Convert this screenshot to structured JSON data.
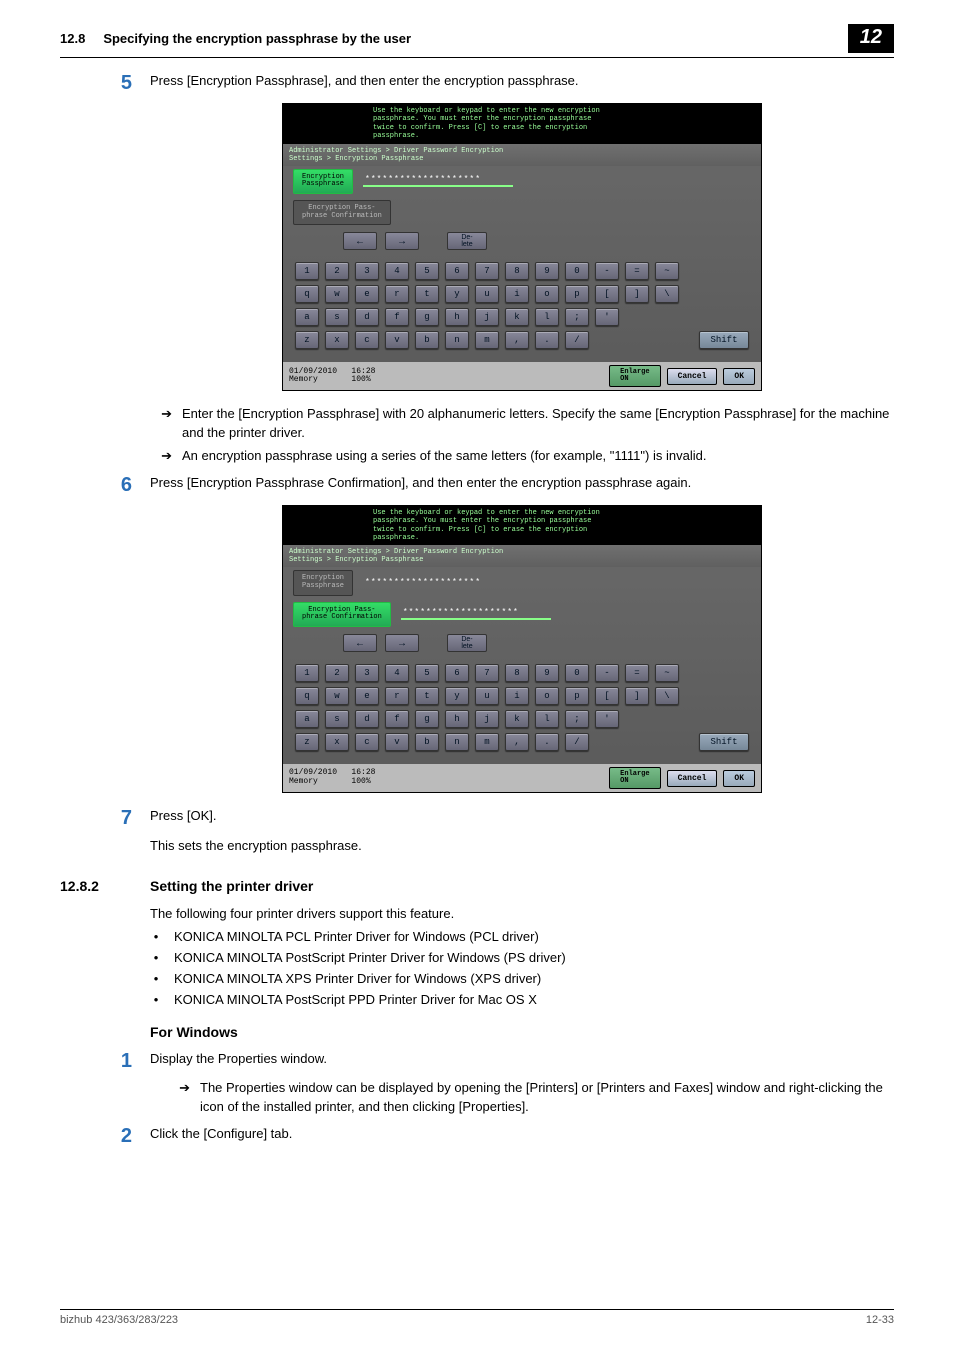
{
  "header": {
    "section_number": "12.8",
    "section_title": "Specifying the encryption passphrase by the user",
    "chapter_number": "12"
  },
  "footer": {
    "model": "bizhub 423/363/283/223",
    "page": "12-33"
  },
  "step5": {
    "num": "5",
    "text": "Press [Encryption Passphrase], and then enter the encryption passphrase.",
    "arrow1": "Enter the [Encryption Passphrase] with 20 alphanumeric letters. Specify the same [Encryption Passphrase] for the machine and the printer driver.",
    "arrow2": "An encryption passphrase using a series of the same letters (for example, \"1111\") is invalid."
  },
  "step6": {
    "num": "6",
    "text": "Press [Encryption Passphrase Confirmation], and then enter the encryption passphrase again."
  },
  "step7": {
    "num": "7",
    "text": "Press [OK].",
    "sub": "This sets the encryption passphrase."
  },
  "sec_1282": {
    "num": "12.8.2",
    "title": "Setting the printer driver",
    "intro": "The following four printer drivers support this feature.",
    "bullets": [
      "KONICA MINOLTA PCL Printer Driver for Windows (PCL driver)",
      "KONICA MINOLTA PostScript Printer Driver for Windows (PS driver)",
      "KONICA MINOLTA XPS Printer Driver for Windows (XPS driver)",
      "KONICA MINOLTA PostScript PPD Printer Driver for Mac OS X"
    ]
  },
  "for_windows": {
    "title": "For Windows",
    "step1_num": "1",
    "step1": "Display the Properties window.",
    "step1_arrow": "The Properties window can be displayed by opening the [Printers] or [Printers and Faxes] window and right-clicking the icon of the installed printer, and then clicking [Properties].",
    "step2_num": "2",
    "step2": "Click the [Configure] tab."
  },
  "screenshot": {
    "topmsg": "Use the keyboard or keypad to enter the new encryption\npassphrase. You must enter the encryption passphrase\ntwice to confirm. Press [C] to erase the encryption\npassphrase.",
    "breadcrumb": "Administrator Settings > Driver Password Encryption\nSettings > Encryption Passphrase",
    "field_encrypt_label": "Encryption\nPassphrase",
    "field_confirm_label": "Encryption Pass-\nphrase Confirmation",
    "value_masked": "********************",
    "delete_label": "De-\nlete",
    "shift_label": "Shift",
    "row_num": [
      "1",
      "2",
      "3",
      "4",
      "5",
      "6",
      "7",
      "8",
      "9",
      "0",
      "-",
      "=",
      "~"
    ],
    "row_q": [
      "q",
      "w",
      "e",
      "r",
      "t",
      "y",
      "u",
      "i",
      "o",
      "p",
      "[",
      "]",
      "\\"
    ],
    "row_a": [
      "a",
      "s",
      "d",
      "f",
      "g",
      "h",
      "j",
      "k",
      "l",
      ";",
      "'"
    ],
    "row_z": [
      "z",
      "x",
      "c",
      "v",
      "b",
      "n",
      "m",
      ",",
      ".",
      "/"
    ],
    "bottom_info": "01/09/2010   16:28\nMemory       100%",
    "enlarge": "Enlarge\nON",
    "cancel": "Cancel",
    "ok": "OK"
  }
}
